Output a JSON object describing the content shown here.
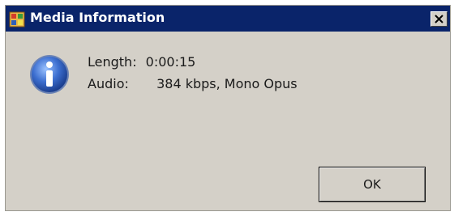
{
  "window": {
    "title": "Media Information",
    "close_glyph": "✕",
    "icon": "media-player-icon"
  },
  "message": {
    "icon": "information-icon",
    "line1_label": "Length:",
    "line1_value": "0:00:15",
    "line2_label": "Audio:",
    "line2_value": "384 kbps, Mono Opus"
  },
  "buttons": {
    "ok_label": "OK"
  },
  "colors": {
    "titlebar": "#0a246a",
    "window_bg": "#d4d0c8",
    "info_icon": "#2f5fb8"
  }
}
